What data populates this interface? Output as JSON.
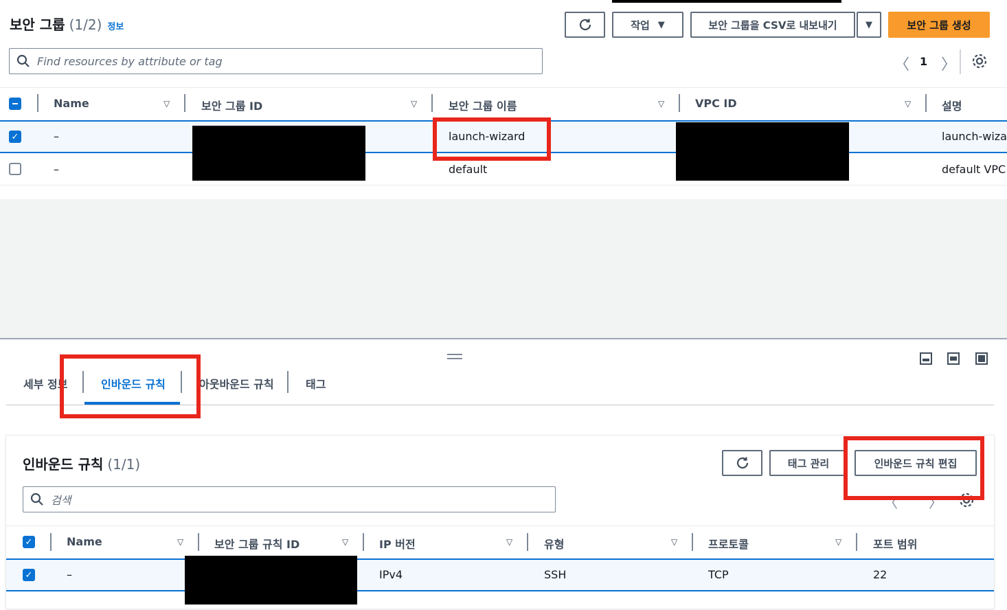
{
  "top": {
    "title": "보안 그룹",
    "count": "(1/2)",
    "info": "정보",
    "actions_label": "작업",
    "export_label": "보안 그룹을 CSV로 내보내기",
    "create_label": "보안 그룹 생성",
    "search_placeholder": "Find resources by attribute or tag",
    "page_number": "1",
    "columns": [
      "Name",
      "보안 그룹 ID",
      "보안 그룹 이름",
      "VPC ID",
      "설명"
    ],
    "rows": [
      {
        "name": "–",
        "group_name": "launch-wizard",
        "description": "launch-wizar"
      },
      {
        "name": "–",
        "group_name": "default",
        "description": "default VPC"
      }
    ]
  },
  "tabs": [
    "세부 정보",
    "인바운드 규칙",
    "아웃바운드 규칙",
    "태그"
  ],
  "inbound": {
    "title": "인바운드 규칙",
    "count": "(1/1)",
    "manage_tags_label": "태그 관리",
    "edit_label": "인바운드 규칙 편집",
    "search_placeholder": "검색",
    "columns": [
      "Name",
      "보안 그룹 규칙 ID",
      "IP 버전",
      "유형",
      "프로토콜",
      "포트 범위"
    ],
    "rows": [
      {
        "name": "–",
        "ip_version": "IPv4",
        "type": "SSH",
        "protocol": "TCP",
        "port": "22"
      }
    ]
  },
  "colors": {
    "accent": "#0972d3",
    "primary_button": "#f89b2c",
    "callout": "#e8261c"
  },
  "icons": [
    "refresh-icon",
    "caret-down-icon",
    "search-icon",
    "chevron-left-icon",
    "chevron-right-icon",
    "gear-icon",
    "drag-handle-icon",
    "panel-bottom-icon",
    "panel-side-icon",
    "panel-full-icon"
  ]
}
